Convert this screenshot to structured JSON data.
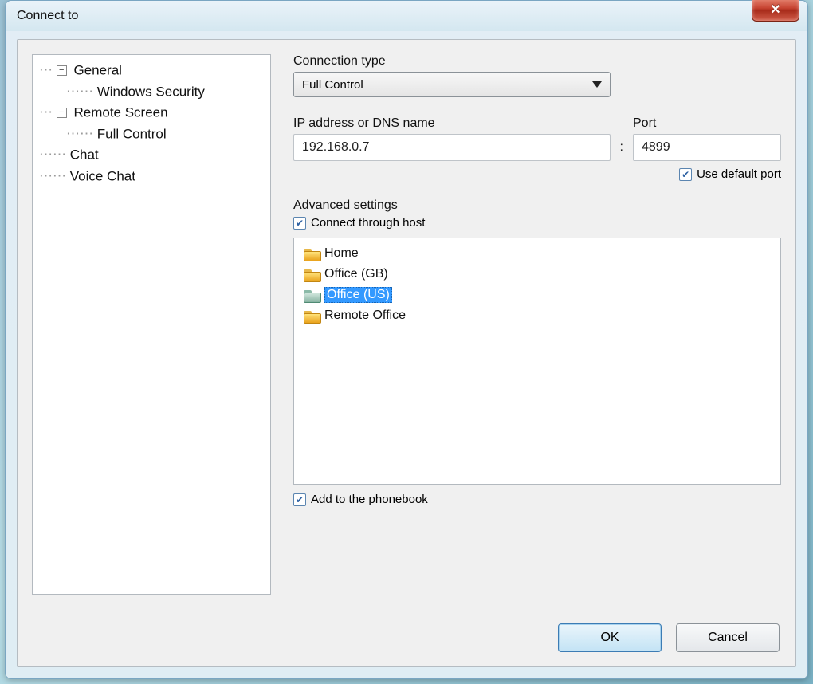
{
  "window": {
    "title": "Connect to"
  },
  "tree": {
    "general": "General",
    "general_child": "Windows Security",
    "remote_screen": "Remote Screen",
    "remote_screen_child": "Full Control",
    "chat": "Chat",
    "voice_chat": "Voice Chat"
  },
  "connection_type": {
    "label": "Connection type",
    "value": "Full Control"
  },
  "ip": {
    "label": "IP address or DNS name",
    "value": "192.168.0.7"
  },
  "port": {
    "label": "Port",
    "value": "4899",
    "use_default_label": "Use default port",
    "use_default_checked": true
  },
  "advanced": {
    "label": "Advanced settings",
    "connect_through_host_label": "Connect through host",
    "connect_through_host_checked": true
  },
  "hosts": [
    {
      "label": "Home",
      "selected": false
    },
    {
      "label": "Office (GB)",
      "selected": false
    },
    {
      "label": "Office (US)",
      "selected": true
    },
    {
      "label": "Remote Office",
      "selected": false
    }
  ],
  "phonebook": {
    "label": "Add to the phonebook",
    "checked": true
  },
  "buttons": {
    "ok": "OK",
    "cancel": "Cancel"
  }
}
